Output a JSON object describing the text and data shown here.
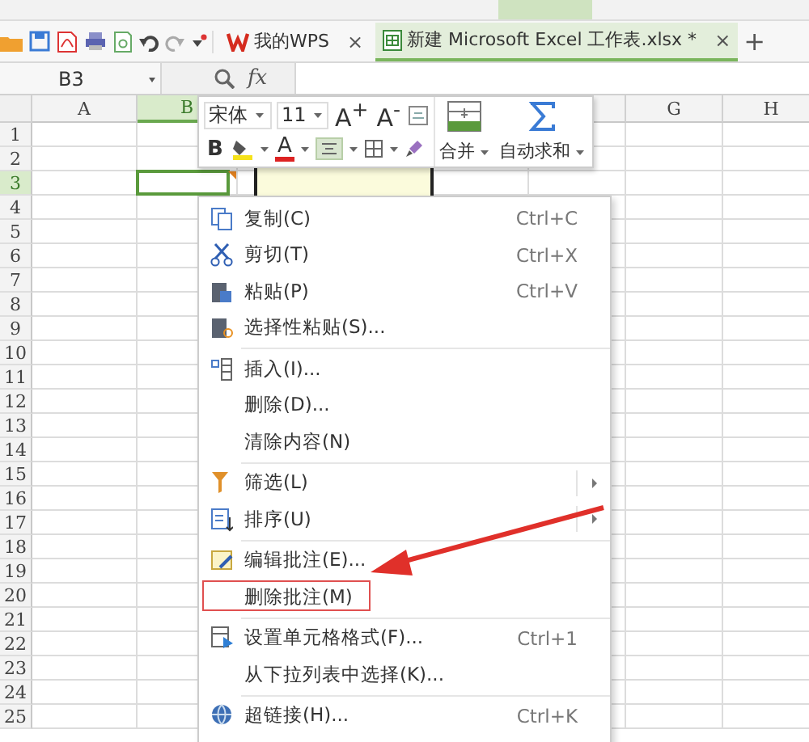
{
  "quick_access": {
    "dropdown": true
  },
  "tabs": [
    {
      "label": "我的WPS",
      "selected": false,
      "close": "×"
    },
    {
      "label": "新建 Microsoft Excel 工作表.xlsx *",
      "selected": true,
      "close": "×"
    }
  ],
  "new_tab": "+",
  "formula_bar": {
    "name_box": "B3",
    "fx": "fx"
  },
  "columns": [
    {
      "label": "A",
      "selected": false
    },
    {
      "label": "B",
      "selected": true
    },
    {
      "label": "G",
      "selected": false
    },
    {
      "label": "H",
      "selected": false
    }
  ],
  "rows": [
    {
      "label": "1",
      "selected": false
    },
    {
      "label": "2",
      "selected": false
    },
    {
      "label": "3",
      "selected": true
    },
    {
      "label": "4",
      "selected": false
    },
    {
      "label": "5",
      "selected": false
    },
    {
      "label": "6",
      "selected": false
    },
    {
      "label": "7",
      "selected": false
    },
    {
      "label": "8",
      "selected": false
    },
    {
      "label": "9",
      "selected": false
    },
    {
      "label": "10",
      "selected": false
    },
    {
      "label": "11",
      "selected": false
    },
    {
      "label": "12",
      "selected": false
    },
    {
      "label": "13",
      "selected": false
    },
    {
      "label": "14",
      "selected": false
    },
    {
      "label": "15",
      "selected": false
    },
    {
      "label": "16",
      "selected": false
    },
    {
      "label": "17",
      "selected": false
    },
    {
      "label": "18",
      "selected": false
    },
    {
      "label": "19",
      "selected": false
    },
    {
      "label": "20",
      "selected": false
    },
    {
      "label": "21",
      "selected": false
    },
    {
      "label": "22",
      "selected": false
    },
    {
      "label": "23",
      "selected": false
    },
    {
      "label": "24",
      "selected": false
    },
    {
      "label": "25",
      "selected": false
    }
  ],
  "mini_toolbar": {
    "font": "宋体",
    "size": "11",
    "grow_font": "A$^{+}$",
    "shrink_font": "A$^{-}$",
    "bold": "B",
    "font_color": "A",
    "align_pressed": true,
    "merge": "合并",
    "autosum": "自动求和"
  },
  "context_menu": {
    "groups": [
      [
        {
          "label": "复制(C)",
          "shortcut": "Ctrl+C",
          "submenu": false,
          "highlighted": false
        },
        {
          "label": "剪切(T)",
          "shortcut": "Ctrl+X",
          "submenu": false,
          "highlighted": false
        },
        {
          "label": "粘贴(P)",
          "shortcut": "Ctrl+V",
          "submenu": false,
          "highlighted": false
        },
        {
          "label": "选择性粘贴(S)...",
          "submenu": false,
          "highlighted": false
        }
      ],
      [
        {
          "label": "插入(I)...",
          "submenu": false,
          "highlighted": false
        },
        {
          "label": "删除(D)...",
          "submenu": false,
          "highlighted": false
        },
        {
          "label": "清除内容(N)",
          "submenu": false,
          "highlighted": false
        }
      ],
      [
        {
          "label": "筛选(L)",
          "submenu": true,
          "highlighted": false
        },
        {
          "label": "排序(U)",
          "submenu": true,
          "highlighted": false
        }
      ],
      [
        {
          "label": "编辑批注(E)...",
          "submenu": false,
          "highlighted": false
        },
        {
          "label": "删除批注(M)",
          "submenu": false,
          "highlighted": true
        }
      ],
      [
        {
          "label": "设置单元格格式(F)...",
          "shortcut": "Ctrl+1",
          "submenu": false,
          "highlighted": false
        },
        {
          "label": "从下拉列表中选择(K)...",
          "submenu": false,
          "highlighted": false
        }
      ],
      [
        {
          "label": "超链接(H)...",
          "shortcut": "Ctrl+K",
          "submenu": false,
          "highlighted": false
        }
      ]
    ]
  }
}
